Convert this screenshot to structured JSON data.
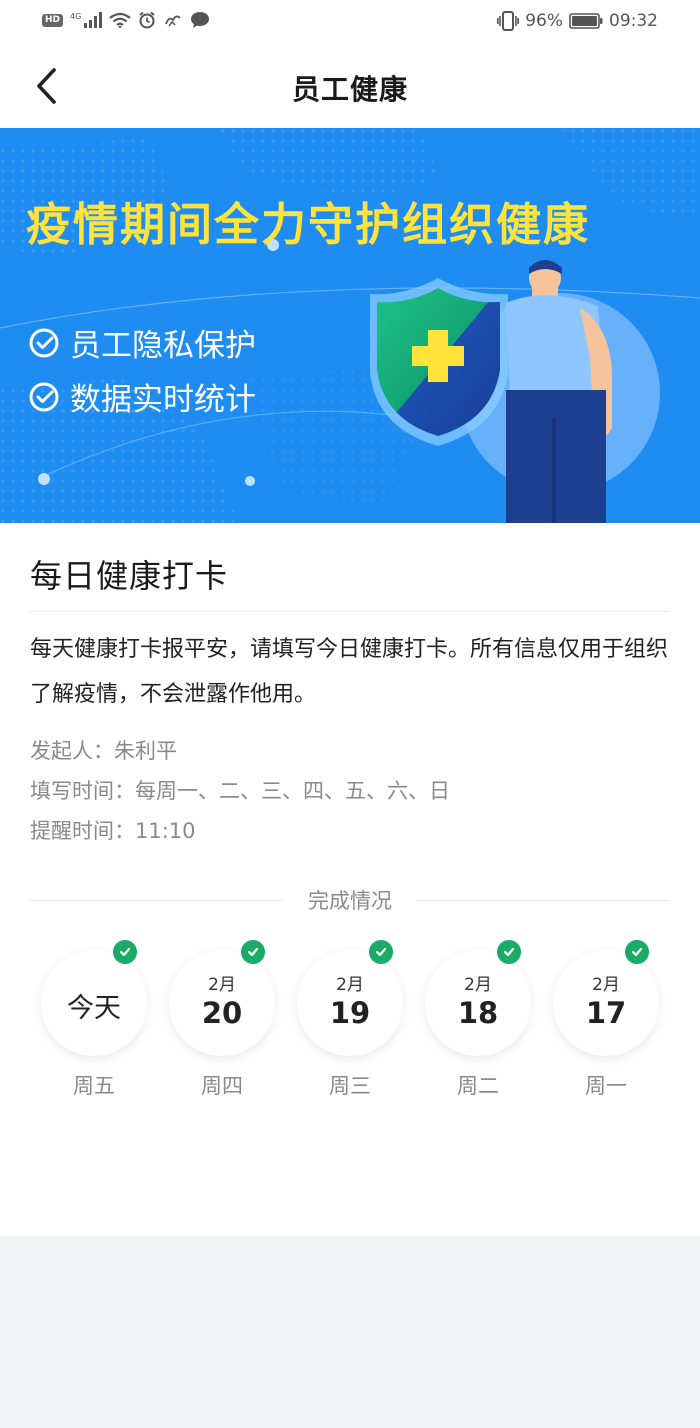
{
  "status_bar": {
    "hd": "HD",
    "network": "4G",
    "battery": "96%",
    "time": "09:32"
  },
  "nav": {
    "title": "员工健康"
  },
  "banner": {
    "headline": "疫情期间全力守护组织健康",
    "features": [
      "员工隐私保护",
      "数据实时统计"
    ]
  },
  "checkin": {
    "title": "每日健康打卡",
    "description": "每天健康打卡报平安，请填写今日健康打卡。所有信息仅用于组织了解疫情，不会泄露作他用。",
    "initiator": "发起人：朱利平",
    "schedule": "填写时间：每周一、二、三、四、五、六、日",
    "reminder": "提醒时间：11:10",
    "progress_label": "完成情况",
    "days": [
      {
        "today": "今天",
        "weekday": "周五"
      },
      {
        "month": "2月",
        "day": "20",
        "weekday": "周四"
      },
      {
        "month": "2月",
        "day": "19",
        "weekday": "周三"
      },
      {
        "month": "2月",
        "day": "18",
        "weekday": "周二"
      },
      {
        "month": "2月",
        "day": "17",
        "weekday": "周一"
      }
    ]
  },
  "colors": {
    "banner_blue": "#1f8cf2",
    "headline_yellow": "#ffe33a",
    "check_green": "#1aac67"
  }
}
